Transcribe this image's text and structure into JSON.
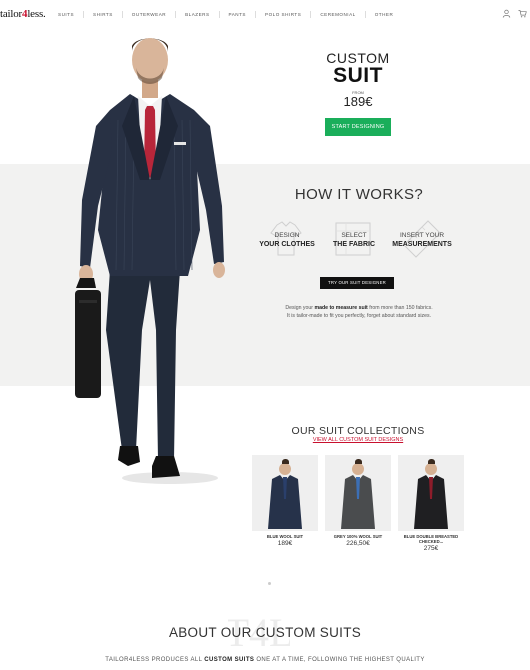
{
  "brand": {
    "logo_text_pre": "tailor",
    "logo_text_num": "4",
    "logo_text_post": "less.",
    "accent": "#c8102e"
  },
  "nav": {
    "items": [
      "SUITS",
      "SHIRTS",
      "OUTERWEAR",
      "BLAZERS",
      "PANTS",
      "POLO SHIRTS",
      "CEREMONIAL",
      "OTHER"
    ],
    "icons": [
      "user-icon",
      "cart-icon"
    ]
  },
  "hero": {
    "line1": "CUSTOM",
    "line2": "SUIT",
    "from_label": "FROM",
    "price": "189€",
    "cta": "START DESIGNING",
    "cta_color": "#1aae5a"
  },
  "how": {
    "title": "HOW IT WORKS?",
    "steps": [
      {
        "top": "DESIGN",
        "bottom": "YOUR CLOTHES",
        "icon": "shirt-icon"
      },
      {
        "top": "SELECT",
        "bottom": "THE FABRIC",
        "icon": "fabric-icon"
      },
      {
        "top": "INSERT YOUR",
        "bottom": "MEASUREMENTS",
        "icon": "measuring-tape-icon"
      }
    ],
    "cta": "TRY OUR SUIT DESIGNER",
    "desc_pre": "Design your ",
    "desc_bold": "made to measure suit",
    "desc_post": " from more than 150 fabrics.",
    "desc_line2": "It is tailor-made to fit you perfectly, forget about standard sizes."
  },
  "collections": {
    "title": "OUR SUIT COLLECTIONS",
    "link": "VIEW ALL CUSTOM SUIT DESIGNS",
    "items": [
      {
        "name": "BLUE WOOL SUIT",
        "price": "189€",
        "suit_color": "#26324a"
      },
      {
        "name": "GREY 100% WOOL SUIT",
        "price": "226,50€",
        "suit_color": "#4a4c4e"
      },
      {
        "name": "BLUE DOUBLE BREASTED CHECKED...",
        "price": "275€",
        "suit_color": "#1f1f22"
      }
    ]
  },
  "about": {
    "title": "ABOUT OUR CUSTOM SUITS",
    "text_pre": "TAILOR4LESS PRODUCES ALL ",
    "text_bold": "CUSTOM SUITS",
    "text_post": " ONE AT A TIME, FOLLOWING THE HIGHEST QUALITY"
  }
}
